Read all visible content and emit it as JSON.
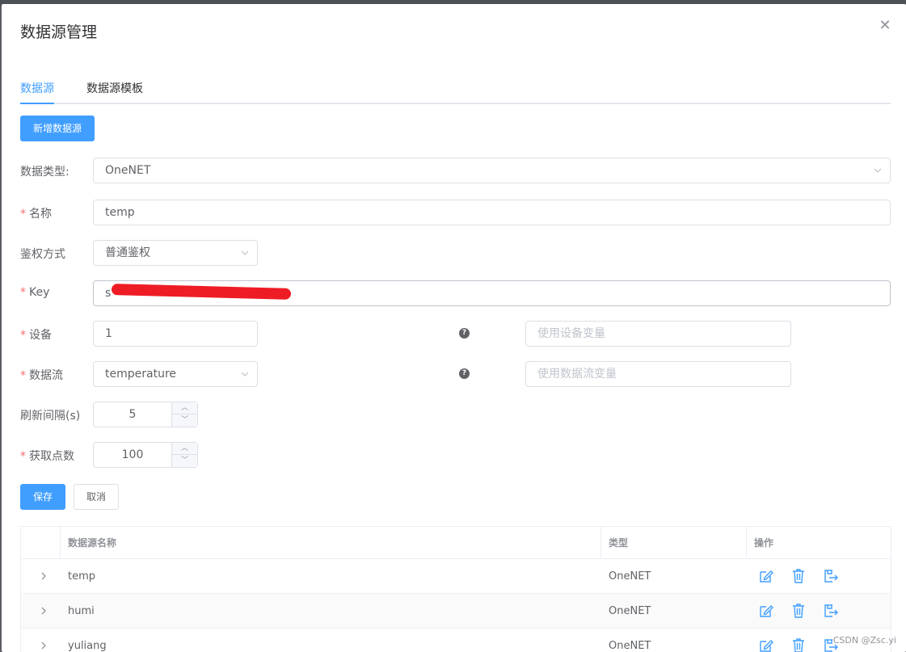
{
  "dialog": {
    "title": "数据源管理",
    "close_icon": "close-icon"
  },
  "tabs": [
    {
      "label": "数据源",
      "active": true
    },
    {
      "label": "数据源模板",
      "active": false
    }
  ],
  "add_button": "新增数据源",
  "form": {
    "type": {
      "label": "数据类型:",
      "value": "OneNET"
    },
    "name": {
      "label": "名称",
      "required": true,
      "value": "temp"
    },
    "auth": {
      "label": "鉴权方式",
      "value": "普通鉴权"
    },
    "key": {
      "label": "Key",
      "required": true,
      "value": "s"
    },
    "device": {
      "label": "设备",
      "required": true,
      "value": "1",
      "var_placeholder": "使用设备变量"
    },
    "stream": {
      "label": "数据流",
      "required": true,
      "value": "temperature",
      "var_placeholder": "使用数据流变量"
    },
    "interval": {
      "label": "刷新间隔(s)",
      "value": "5"
    },
    "points": {
      "label": "获取点数",
      "required": true,
      "value": "100"
    }
  },
  "actions": {
    "save": "保存",
    "cancel": "取消"
  },
  "table": {
    "columns": [
      "数据源名称",
      "类型",
      "操作"
    ],
    "rows": [
      {
        "name": "temp",
        "type": "OneNET"
      },
      {
        "name": "humi",
        "type": "OneNET"
      },
      {
        "name": "yuliang",
        "type": "OneNET"
      }
    ]
  },
  "colors": {
    "primary": "#409eff",
    "required": "#f56c6c",
    "redaction": "#ee1c25"
  },
  "watermark": "CSDN @Zsc.yi"
}
